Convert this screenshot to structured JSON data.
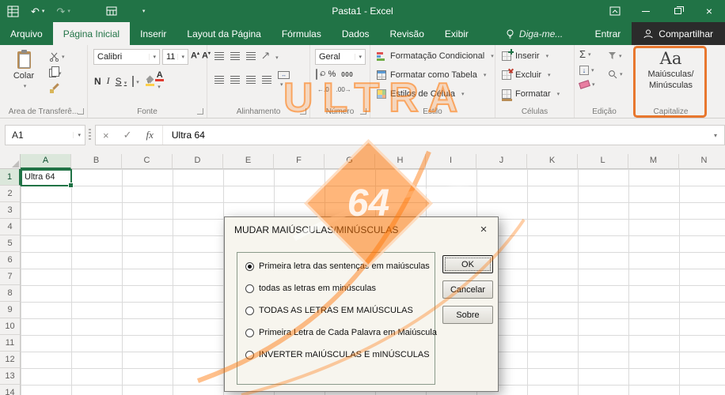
{
  "titlebar": {
    "title": "Pasta1 - Excel"
  },
  "window_icons": {
    "undo": "↶",
    "redo": "↷"
  },
  "tabs": [
    {
      "label": "Arquivo"
    },
    {
      "label": "Página Inicial",
      "active": true
    },
    {
      "label": "Inserir"
    },
    {
      "label": "Layout da Página"
    },
    {
      "label": "Fórmulas"
    },
    {
      "label": "Dados"
    },
    {
      "label": "Revisão"
    },
    {
      "label": "Exibir"
    }
  ],
  "tellme_label": "Diga-me...",
  "account": {
    "sign_in": "Entrar",
    "share": "Compartilhar"
  },
  "ribbon": {
    "clipboard": {
      "paste": "Colar",
      "label": "Área de Transferê..."
    },
    "font": {
      "family": "Calibri",
      "size": "11",
      "bold": "N",
      "italic": "I",
      "underline": "S",
      "grow": "A",
      "shrink": "A",
      "color_letter": "A",
      "label": "Fonte"
    },
    "alignment": {
      "label": "Alinhamento",
      "merge_glyph": "↔"
    },
    "number": {
      "format": "Geral",
      "percent": "%",
      "thousands": "000",
      "inc_decimal": "←.0",
      "dec_decimal": ".00→",
      "label": "Número"
    },
    "styles": {
      "items": [
        "Formatação Condicional",
        "Formatar como Tabela",
        "Estilos de Célula"
      ],
      "label": "Estilo"
    },
    "cells": {
      "items": [
        "Inserir",
        "Excluir",
        "Formatar"
      ],
      "label": "Células"
    },
    "editing": {
      "autosum": "Σ",
      "fill_glyph": "↓",
      "label": "Edição"
    },
    "capitalize": {
      "icon": "Aa",
      "line1": "Maiúsculas/",
      "line2": "Minúsculas",
      "label": "Capitalize",
      "highlight_color": "#e8772e"
    }
  },
  "formula_bar": {
    "name_box": "A1",
    "cancel": "×",
    "enter": "✓",
    "fx": "fx",
    "value": "Ultra 64"
  },
  "grid": {
    "columns": [
      "A",
      "B",
      "C",
      "D",
      "E",
      "F",
      "G",
      "H",
      "I",
      "J",
      "K",
      "L",
      "M",
      "N"
    ],
    "rows": [
      "1",
      "2",
      "3",
      "4",
      "5",
      "6",
      "7",
      "8",
      "9",
      "10",
      "11",
      "12",
      "13",
      "14"
    ],
    "active_cell": "A1",
    "active_value": "Ultra 64"
  },
  "dialog": {
    "title": "MUDAR MAIÚSCULAS/MINÚSCULAS",
    "close": "×",
    "options": [
      {
        "label": "Primeira letra das sentenças em maiúsculas",
        "selected": true
      },
      {
        "label": "todas as letras em minúsculas",
        "selected": false
      },
      {
        "label": "TODAS AS LETRAS EM MAIÚSCULAS",
        "selected": false
      },
      {
        "label": "Primeira Letra de Cada Palavra em Maiúscula",
        "selected": false
      },
      {
        "label": "INVERTER mAIÚSCULAS E mINÚSCULAS",
        "selected": false
      }
    ],
    "buttons": {
      "ok": "OK",
      "cancel": "Cancelar",
      "about": "Sobre"
    }
  },
  "watermark": {
    "word": "ULTRA",
    "number": "64",
    "color": "#ff7300"
  }
}
